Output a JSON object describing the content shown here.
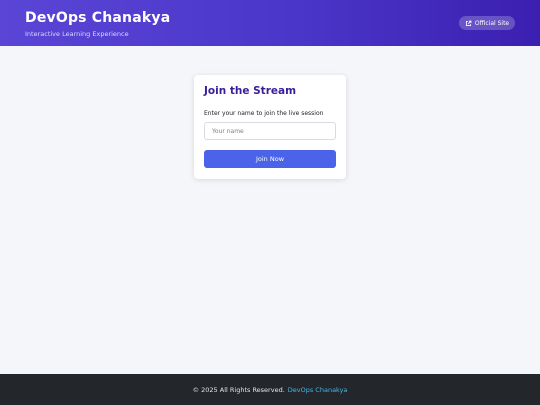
{
  "header": {
    "title": "DevOps Chanakya",
    "subtitle": "Interactive Learning Experience",
    "official_site_label": "Official Site",
    "colors": {
      "gradient_start": "#5a45d6",
      "gradient_end": "#3b1fb0"
    }
  },
  "card": {
    "title": "Join the Stream",
    "prompt": "Enter your name to join the live session",
    "name_placeholder": "Your name",
    "join_label": "Join Now",
    "colors": {
      "title": "#3a1d9a",
      "button": "#4a63e8"
    }
  },
  "footer": {
    "copyright": "© 2025 All Rights Reserved.",
    "link_label": "DevOps Chanakya",
    "colors": {
      "background": "#23272c",
      "link": "#43b8e6"
    }
  },
  "icons": {
    "official_site": "external-link-icon"
  }
}
